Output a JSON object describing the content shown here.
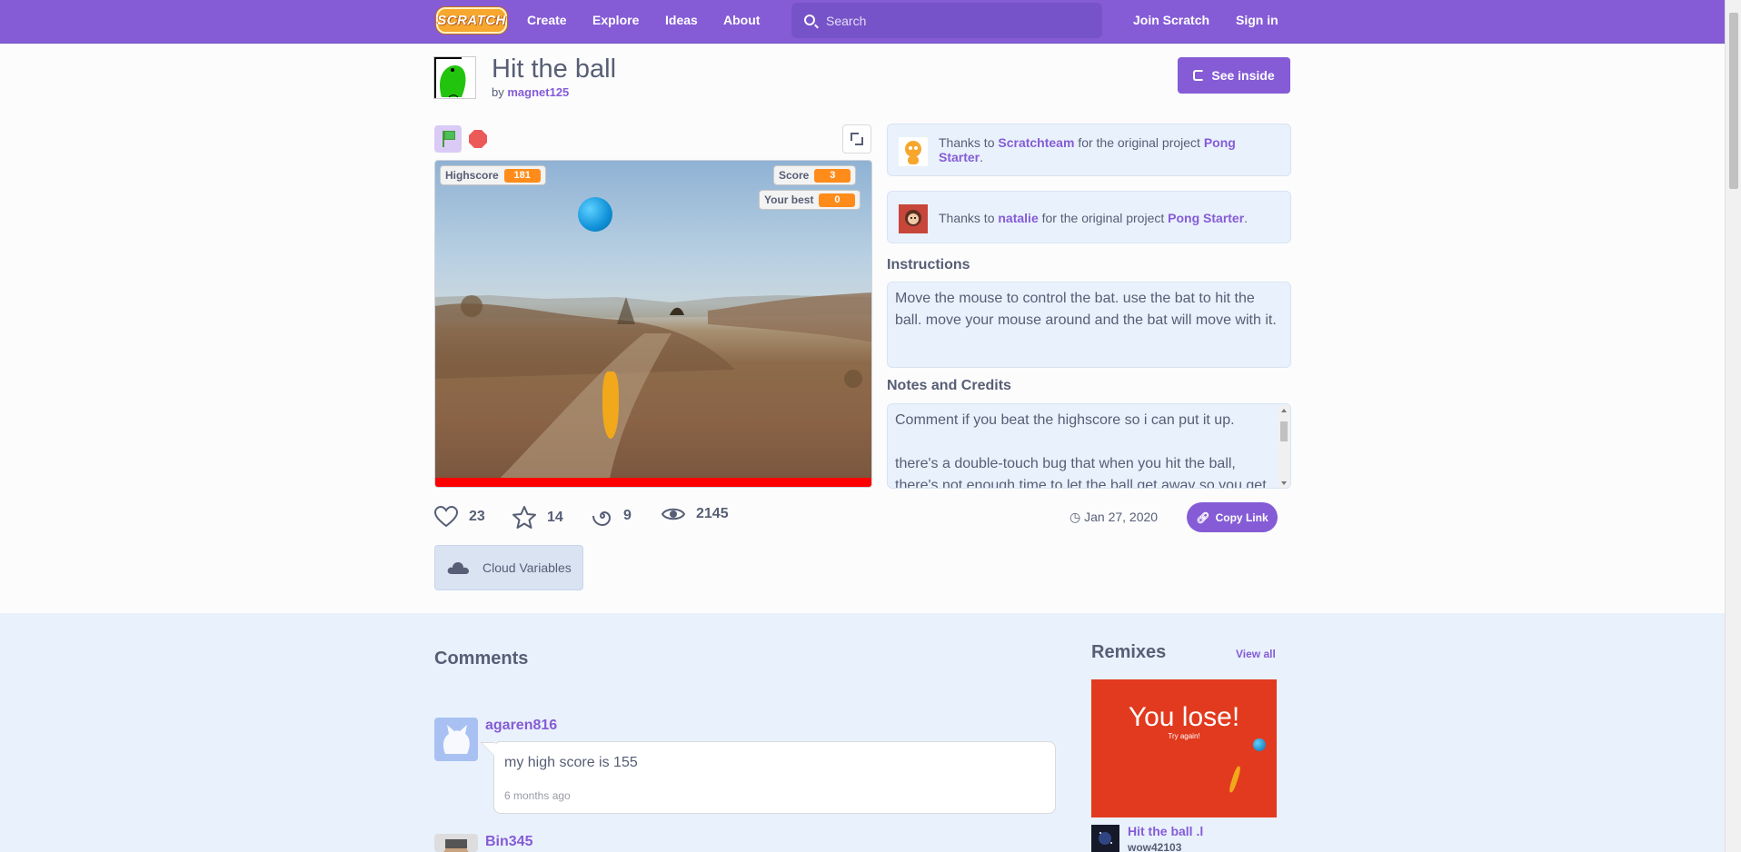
{
  "nav": {
    "logo": "SCRATCH",
    "links": [
      "Create",
      "Explore",
      "Ideas",
      "About"
    ],
    "search_placeholder": "Search",
    "join": "Join Scratch",
    "signin": "Sign in"
  },
  "project": {
    "title": "Hit the ball",
    "by": "by",
    "author": "magnet125",
    "see_inside": "See inside"
  },
  "stage": {
    "monitors": {
      "highscore_label": "Highscore",
      "highscore_value": "181",
      "score_label": "Score",
      "score_value": "3",
      "best_label": "Your best",
      "best_value": "0"
    }
  },
  "credits": [
    {
      "thanks": "Thanks to",
      "user": "Scratchteam",
      "mid": "for the original project",
      "project": "Pong Starter",
      "end": "."
    },
    {
      "thanks": "Thanks to",
      "user": "natalie",
      "mid": "for the original project",
      "project": "Pong Starter",
      "end": "."
    }
  ],
  "instructions": {
    "title": "Instructions",
    "text": "Move the mouse to control the bat. use the bat to hit the ball. move your mouse around and the bat will move with it."
  },
  "notes": {
    "title": "Notes and Credits",
    "line1": "Comment if you beat the highscore so i can put it up.",
    "line2": "there's a double-touch bug that when you hit the ball, there's not enough time to let the ball get away so you get"
  },
  "stats": {
    "loves": "23",
    "favorites": "14",
    "remixes": "9",
    "views": "2145"
  },
  "shared_date": "Jan 27, 2020",
  "copy_link": "Copy Link",
  "cloud_variables": "Cloud Variables",
  "comments": {
    "title": "Comments",
    "items": [
      {
        "user": "agaren816",
        "text": "my high score is 155",
        "time": "6 months ago"
      },
      {
        "user": "Bin345"
      }
    ]
  },
  "remixes": {
    "title": "Remixes",
    "view_all": "View all",
    "thumb_big": "You lose!",
    "thumb_small": "Try again!",
    "item_title": "Hit the ball .l",
    "item_owner": "wow42103"
  },
  "colors": {
    "brand": "#855cd6",
    "text": "#575e75",
    "monitor": "#ff8c1a",
    "bg_light": "#e9f1fc"
  }
}
